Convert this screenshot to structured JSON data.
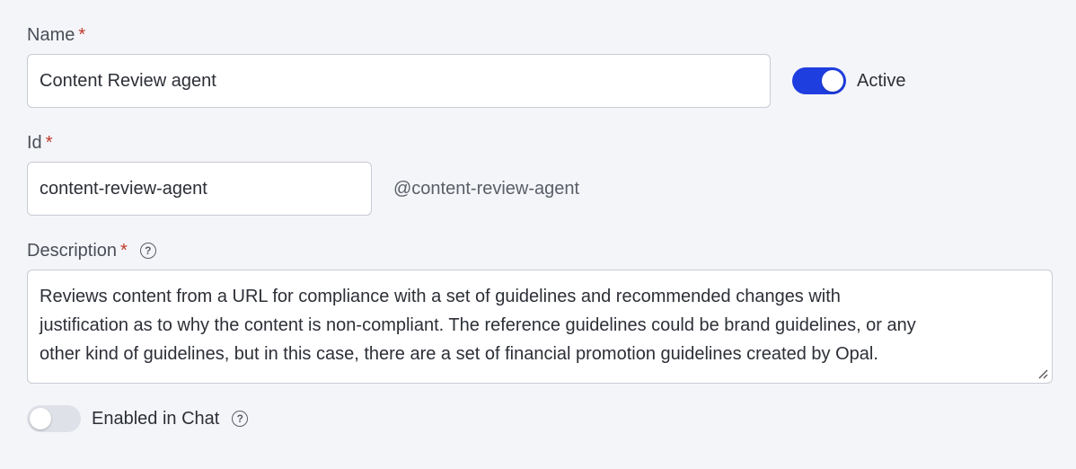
{
  "name_field": {
    "label": "Name",
    "required_mark": "*",
    "value": "Content Review agent"
  },
  "active_toggle": {
    "label": "Active",
    "on": true,
    "color": "#1f3ee0"
  },
  "id_field": {
    "label": "Id",
    "required_mark": "*",
    "value": "content-review-agent",
    "handle": "@content-review-agent"
  },
  "description_field": {
    "label": "Description",
    "required_mark": "*",
    "help_icon": "question-circle-icon",
    "lines": [
      "Reviews content from a URL for compliance with a set of guidelines and recommended changes with",
      "justification as to why the content is non-compliant. The reference guidelines could be brand guidelines, or any",
      "other kind of guidelines, but in this case, there are a set of financial promotion guidelines created by Opal."
    ]
  },
  "chat_toggle": {
    "label": "Enabled in Chat",
    "on": false,
    "help_icon": "question-circle-icon"
  }
}
